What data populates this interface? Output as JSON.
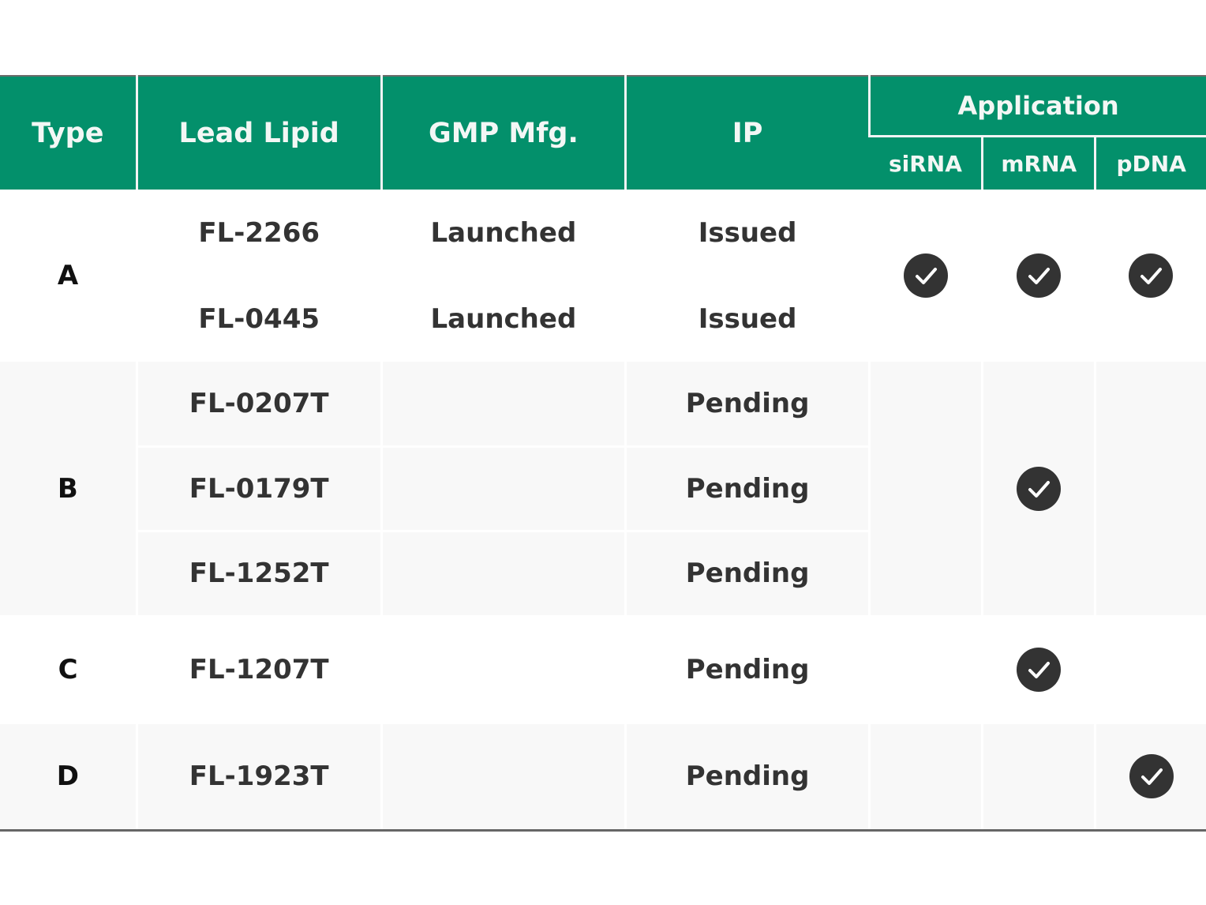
{
  "header": {
    "type": "Type",
    "lead_lipid": "Lead Lipid",
    "gmp_mfg": "GMP Mfg.",
    "ip": "IP",
    "application": "Application",
    "app_sub": [
      "siRNA",
      "mRNA",
      "pDNA"
    ]
  },
  "icons": {
    "check": "check-circle-icon"
  },
  "colors": {
    "header_bg": "#03906b",
    "check_bg": "#333333",
    "alt_row_bg": "#f8f8f8"
  },
  "groups": [
    {
      "type": "A",
      "rows": [
        {
          "lead_lipid": "FL-2266",
          "gmp_mfg": "Launched",
          "ip": "Issued"
        },
        {
          "lead_lipid": "FL-0445",
          "gmp_mfg": "Launched",
          "ip": "Issued"
        }
      ],
      "application": {
        "siRNA": true,
        "mRNA": true,
        "pDNA": true
      }
    },
    {
      "type": "B",
      "rows": [
        {
          "lead_lipid": "FL-0207T",
          "gmp_mfg": "",
          "ip": "Pending"
        },
        {
          "lead_lipid": "FL-0179T",
          "gmp_mfg": "",
          "ip": "Pending"
        },
        {
          "lead_lipid": "FL-1252T",
          "gmp_mfg": "",
          "ip": "Pending"
        }
      ],
      "application": {
        "siRNA": false,
        "mRNA": true,
        "pDNA": false
      }
    },
    {
      "type": "C",
      "rows": [
        {
          "lead_lipid": "FL-1207T",
          "gmp_mfg": "",
          "ip": "Pending"
        }
      ],
      "application": {
        "siRNA": false,
        "mRNA": true,
        "pDNA": false
      }
    },
    {
      "type": "D",
      "rows": [
        {
          "lead_lipid": "FL-1923T",
          "gmp_mfg": "",
          "ip": "Pending"
        }
      ],
      "application": {
        "siRNA": false,
        "mRNA": false,
        "pDNA": true
      }
    }
  ]
}
